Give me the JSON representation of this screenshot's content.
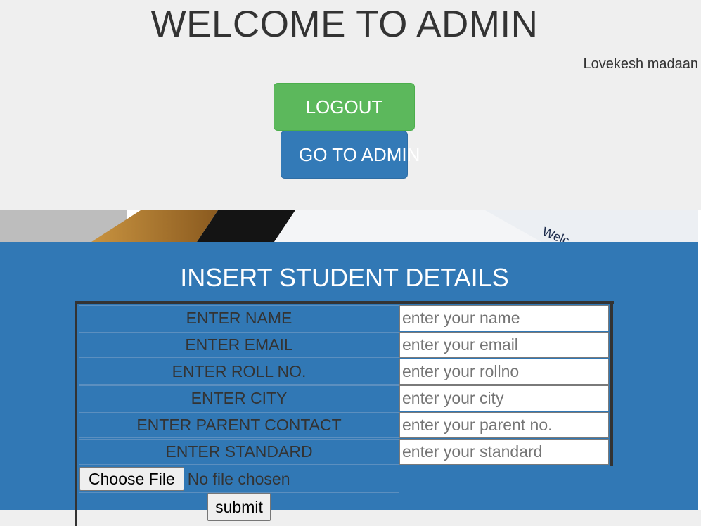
{
  "header": {
    "title": "WELCOME TO ADMIN",
    "user_name": "Lovekesh madaan",
    "logout_label": "LOGOUT",
    "go_admin_label": "GO TO ADMIN"
  },
  "banner": {
    "partial_text": "Welc"
  },
  "form": {
    "title": "INSERT STUDENT DETAILS",
    "rows": [
      {
        "label": "ENTER NAME",
        "placeholder": "enter your name"
      },
      {
        "label": "ENTER EMAIL",
        "placeholder": "enter your email"
      },
      {
        "label": "ENTER ROLL NO.",
        "placeholder": "enter your rollno"
      },
      {
        "label": "ENTER CITY",
        "placeholder": "enter your city"
      },
      {
        "label": "ENTER PARENT CONTACT",
        "placeholder": "enter your parent no."
      },
      {
        "label": "ENTER STANDARD",
        "placeholder": "enter your standard"
      }
    ],
    "file_button_label": "Choose File",
    "file_status": "No file chosen",
    "submit_label": "submit"
  },
  "colors": {
    "logout": "#5cb85c",
    "primary": "#337ab7",
    "panel": "#3178b5"
  }
}
